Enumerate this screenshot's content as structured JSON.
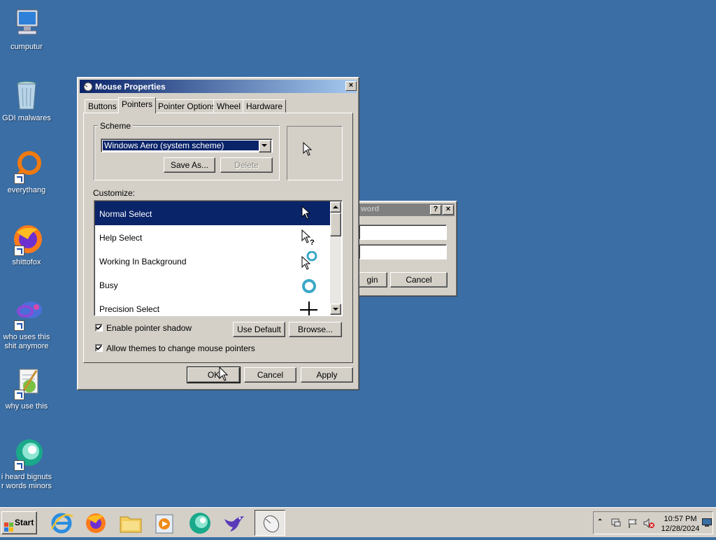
{
  "desktop": {
    "icons": [
      {
        "label": "cumputur"
      },
      {
        "label": "GDI malwares"
      },
      {
        "label": "everythang"
      },
      {
        "label": "shittofox"
      },
      {
        "label": "who uses this shit anymore"
      },
      {
        "label": "why use this"
      },
      {
        "label": "i heard bignuts r words minors"
      }
    ]
  },
  "login_dialog": {
    "title_fragment": "word",
    "help_label": "?",
    "close_label": "×",
    "login_fragment": "gin",
    "cancel_label": "Cancel"
  },
  "dialog": {
    "title": "Mouse Properties",
    "close_label": "×",
    "tabs": [
      "Buttons",
      "Pointers",
      "Pointer Options",
      "Wheel",
      "Hardware"
    ],
    "active_tab": "Pointers",
    "scheme": {
      "group_label": "Scheme",
      "selected": "Windows Aero (system scheme)",
      "save_as_label": "Save As...",
      "delete_label": "Delete"
    },
    "customize_label": "Customize:",
    "pointers": [
      {
        "name": "Normal Select",
        "icon": "arrow-cursor-icon"
      },
      {
        "name": "Help Select",
        "icon": "help-cursor-icon"
      },
      {
        "name": "Working In Background",
        "icon": "working-cursor-icon"
      },
      {
        "name": "Busy",
        "icon": "busy-cursor-icon"
      },
      {
        "name": "Precision Select",
        "icon": "crosshair-cursor-icon"
      }
    ],
    "selected_pointer": "Normal Select",
    "enable_shadow_label": "Enable pointer shadow",
    "enable_shadow_checked": true,
    "allow_themes_label": "Allow themes to change mouse pointers",
    "allow_themes_checked": true,
    "use_default_label": "Use Default",
    "browse_label": "Browse...",
    "ok_label": "OK",
    "cancel_label": "Cancel",
    "apply_label": "Apply"
  },
  "taskbar": {
    "start_label": "Start",
    "pinned": [
      "internet-explorer-icon",
      "firefox-icon",
      "file-explorer-icon",
      "media-player-icon",
      "chat-app-icon",
      "bird-app-icon"
    ],
    "active_task_icon": "mouse-icon",
    "clock_time": "10:57 PM",
    "clock_date": "12/28/2024"
  },
  "colors": {
    "desktop": "#3a6ea5",
    "title_active_start": "#0a246a",
    "title_active_end": "#a6caf0",
    "face": "#d4d0c8"
  }
}
